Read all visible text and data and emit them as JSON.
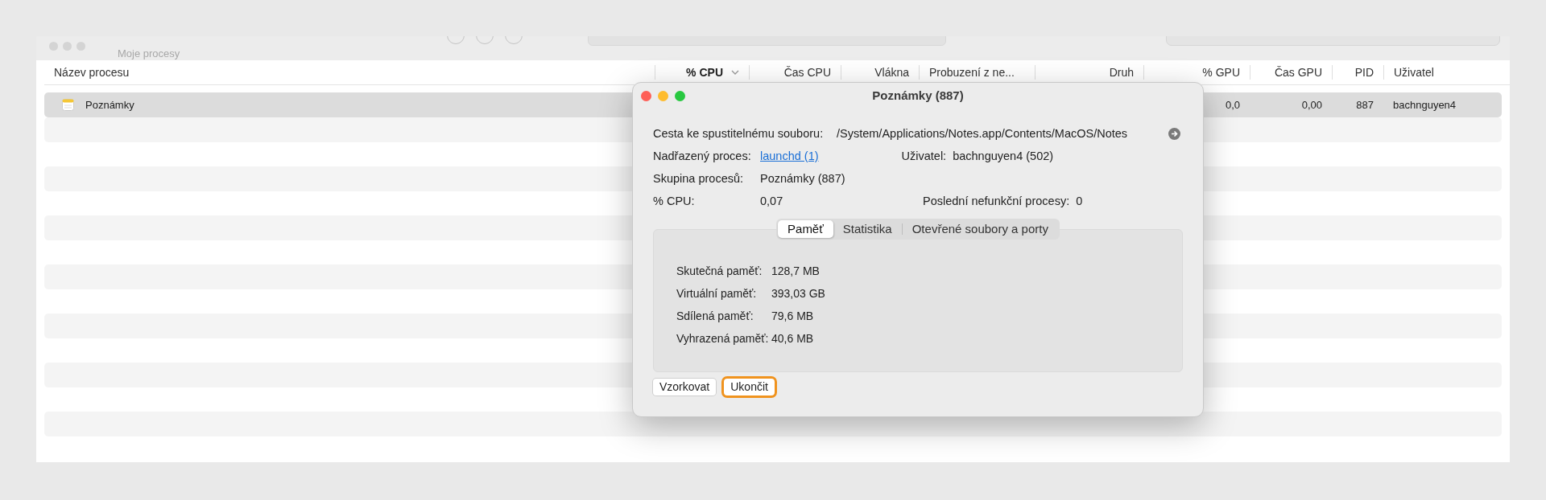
{
  "toolbar": {
    "subtitle": "Moje procesy"
  },
  "table": {
    "columns": [
      {
        "label": "Název procesu",
        "sorted": false
      },
      {
        "label": "% CPU",
        "sorted": true
      },
      {
        "label": "Čas CPU",
        "sorted": false
      },
      {
        "label": "Vlákna",
        "sorted": false
      },
      {
        "label": "Probuzení z ne...",
        "sorted": false
      },
      {
        "label": "Druh",
        "sorted": false
      },
      {
        "label": "% GPU",
        "sorted": false
      },
      {
        "label": "Čas GPU",
        "sorted": false
      },
      {
        "label": "PID",
        "sorted": false
      },
      {
        "label": "Uživatel",
        "sorted": false
      }
    ],
    "rows": [
      {
        "selected": true,
        "name": "Poznámky",
        "gpu": "0,0",
        "gpu_time": "0,00",
        "pid": "887",
        "user": "bachnguyen4"
      }
    ]
  },
  "dialog": {
    "title": "Poznámky (887)",
    "path": {
      "label": "Cesta ke spustitelnému souboru:",
      "value": "/System/Applications/Notes.app/Contents/MacOS/Notes"
    },
    "parent": {
      "label": "Nadřazený proces:",
      "value": "launchd (1)"
    },
    "user": {
      "label": "Uživatel:",
      "value": "bachnguyen4 (502)"
    },
    "group": {
      "label": "Skupina procesů:",
      "value": "Poznámky (887)"
    },
    "cpu": {
      "label": "% CPU:",
      "value": "0,07"
    },
    "crashes": {
      "label": "Poslední nefunkční procesy:",
      "value": "0"
    },
    "tabs": [
      {
        "label": "Paměť",
        "selected": true
      },
      {
        "label": "Statistika",
        "selected": false
      },
      {
        "label": "Otevřené soubory a porty",
        "selected": false
      }
    ],
    "memory": [
      {
        "label": "Skutečná paměť:",
        "value": "128,7 MB"
      },
      {
        "label": "Virtuální paměť:",
        "value": "393,03 GB"
      },
      {
        "label": "Sdílená paměť:",
        "value": "79,6 MB"
      },
      {
        "label": "Vyhrazená paměť:",
        "value": "40,6 MB"
      }
    ],
    "buttons": [
      {
        "label": "Vzorkovat",
        "focused": false
      },
      {
        "label": "Ukončit",
        "focused": true
      }
    ]
  }
}
